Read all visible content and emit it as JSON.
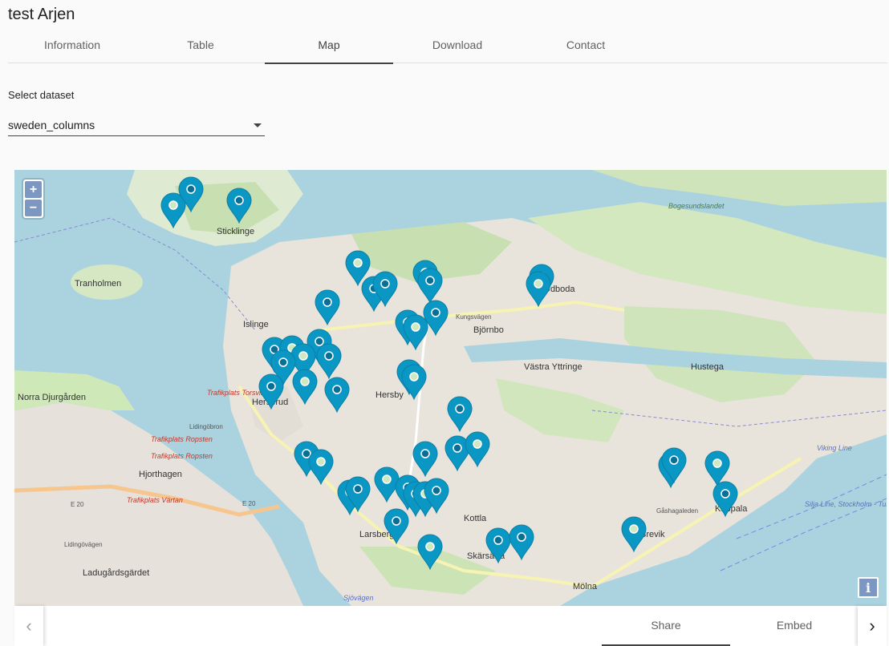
{
  "app": {
    "title": "test Arjen"
  },
  "tabs": [
    {
      "label": "Information",
      "active": false
    },
    {
      "label": "Table",
      "active": false
    },
    {
      "label": "Map",
      "active": true
    },
    {
      "label": "Download",
      "active": false
    },
    {
      "label": "Contact",
      "active": false
    }
  ],
  "dataset": {
    "label": "Select dataset",
    "value": "sweden_columns"
  },
  "map": {
    "zoom_in": "+",
    "zoom_out": "−",
    "info": "i",
    "labels": {
      "sticklinge": "Sticklinge",
      "tranholmen": "Tranholmen",
      "islinge": "Islinge",
      "bjornbo": "Björnbo",
      "vastra_yttringe": "Västra Yttringe",
      "hustega": "Hustega",
      "norra_djurgarden": "Norra Djurgården",
      "herserud": "Herserud",
      "hersby": "Hersby",
      "hjorthagen": "Hjorthagen",
      "ladugardsgardet": "Ladugårdsgärdet",
      "kottla": "Kottla",
      "molna": "Mölna",
      "larsberg": "Larsberg",
      "skarsatra": "Skärsätra",
      "brevik": "Brevik",
      "kappala": "Kappala",
      "udboda": "Udboda",
      "bogesundslandet": "Bogesundslandet",
      "lidingobron": "Lidingöbron",
      "trafikplats_ropsten": "Trafikplats Ropsten",
      "trafikplats_vartan": "Trafikplats Värtan",
      "trafikplats_torsvik": "Trafikplats Torsvik",
      "e20": "E 20",
      "kungsvagen": "Kungsvägen",
      "gashagaleden": "Gåshagaleden",
      "sjovagen": "Sjövägen",
      "lidingovagen": "Lidingövägen",
      "silja_line": "Silja Line, Stockholm - Turku",
      "viking_line": "Viking Line"
    },
    "marker_color": "#0b97c4"
  },
  "bottom_tabs": [
    {
      "label": "Share",
      "active": true
    },
    {
      "label": "Embed",
      "active": false
    }
  ],
  "nav": {
    "prev": "‹",
    "next": "›"
  }
}
